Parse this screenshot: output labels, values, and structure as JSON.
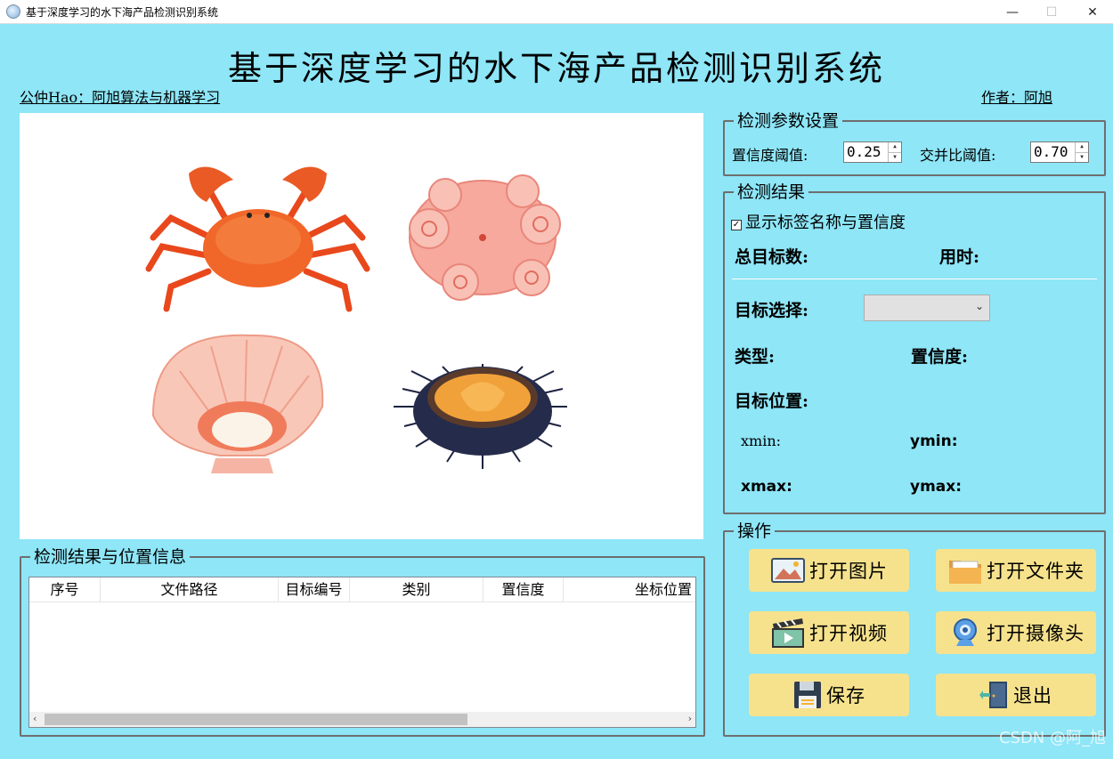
{
  "window": {
    "title": "基于深度学习的水下海产品检测识别系统",
    "minimize": "—",
    "maximize": "☐",
    "close": "✕"
  },
  "header": {
    "title": "基于深度学习的水下海产品检测识别系统",
    "left_note": "公仲Hao：阿旭算法与机器学习",
    "author": "作者：阿旭"
  },
  "params": {
    "legend": "检测参数设置",
    "conf_label": "置信度阈值:",
    "conf_value": "0.25",
    "iou_label": "交并比阈值:",
    "iou_value": "0.70"
  },
  "result": {
    "legend": "检测结果",
    "show_labels": "显示标签名称与置信度",
    "total_label": "总目标数:",
    "time_label": "用时:",
    "select_label": "目标选择:",
    "type_label": "类型:",
    "conf_label": "置信度:",
    "pos_label": "目标位置:",
    "xmin_label": "xmin:",
    "ymin_label": "ymin:",
    "xmax_label": "xmax:",
    "ymax_label": "ymax:"
  },
  "table": {
    "legend": "检测结果与位置信息",
    "columns": [
      "序号",
      "文件路径",
      "目标编号",
      "类别",
      "置信度",
      "坐标位置"
    ]
  },
  "ops": {
    "legend": "操作",
    "open_image": "打开图片",
    "open_folder": "打开文件夹",
    "open_video": "打开视频",
    "open_camera": "打开摄像头",
    "save": "保存",
    "exit": "退出"
  },
  "watermark": "CSDN @阿_旭"
}
